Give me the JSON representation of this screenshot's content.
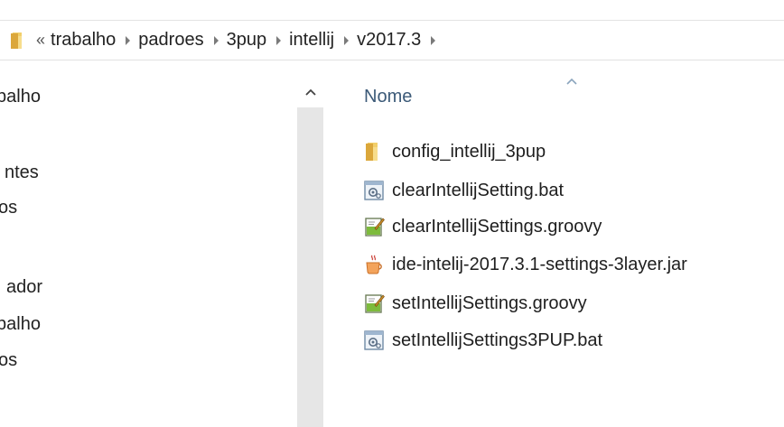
{
  "address_bar": {
    "overflow": "«",
    "crumbs": [
      "trabalho",
      "padroes",
      "3pup",
      "intellij",
      "v2017.3"
    ]
  },
  "nav_pane": {
    "items": [
      "balho",
      "ntes",
      "os",
      "ador",
      "balho",
      "os"
    ]
  },
  "file_list": {
    "column_name": "Nome",
    "files": [
      {
        "name": "config_intellij_3pup",
        "icon": "folder-icon"
      },
      {
        "name": "clearIntellijSetting.bat",
        "icon": "batch-file-icon"
      },
      {
        "name": "clearIntellijSettings.groovy",
        "icon": "script-file-icon"
      },
      {
        "name": "ide-intelij-2017.3.1-settings-3layer.jar",
        "icon": "java-jar-icon"
      },
      {
        "name": "setIntellijSettings.groovy",
        "icon": "script-file-icon"
      },
      {
        "name": "setIntellijSettings3PUP.bat",
        "icon": "batch-file-icon"
      }
    ]
  },
  "colors": {
    "folder": "#e8b84a",
    "header_text": "#3c5a78",
    "scroll_track": "#e6e6e6"
  }
}
